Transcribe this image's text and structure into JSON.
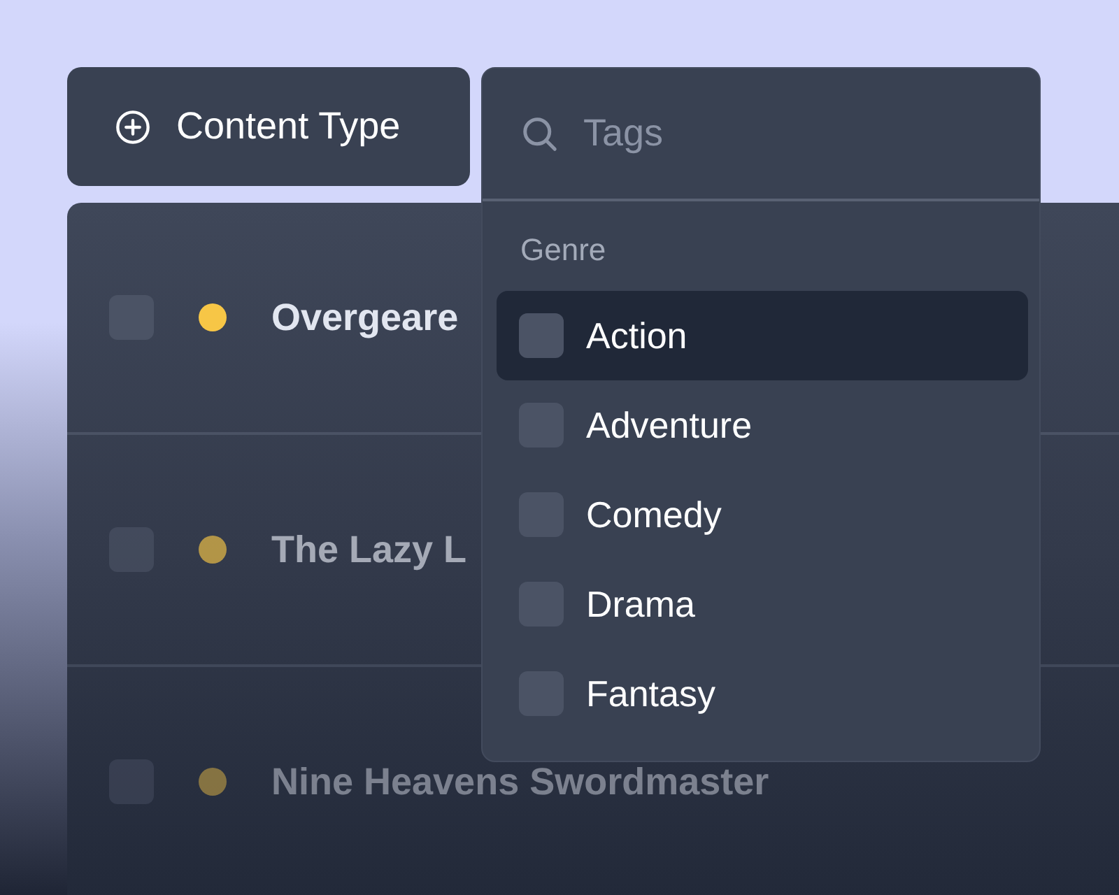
{
  "filter_button": {
    "label": "Content Type"
  },
  "dropdown": {
    "search": {
      "placeholder": "Tags"
    },
    "group_label": "Genre",
    "options": [
      {
        "label": "Action",
        "checked": false,
        "highlighted": true
      },
      {
        "label": "Adventure",
        "checked": false,
        "highlighted": false
      },
      {
        "label": "Comedy",
        "checked": false,
        "highlighted": false
      },
      {
        "label": "Drama",
        "checked": false,
        "highlighted": false
      },
      {
        "label": "Fantasy",
        "checked": false,
        "highlighted": false
      }
    ]
  },
  "table": {
    "rows": [
      {
        "title": "Overgeare",
        "checked": false
      },
      {
        "title": "The Lazy L",
        "checked": false
      },
      {
        "title": "Nine Heavens Swordmaster",
        "checked": false
      }
    ]
  }
}
